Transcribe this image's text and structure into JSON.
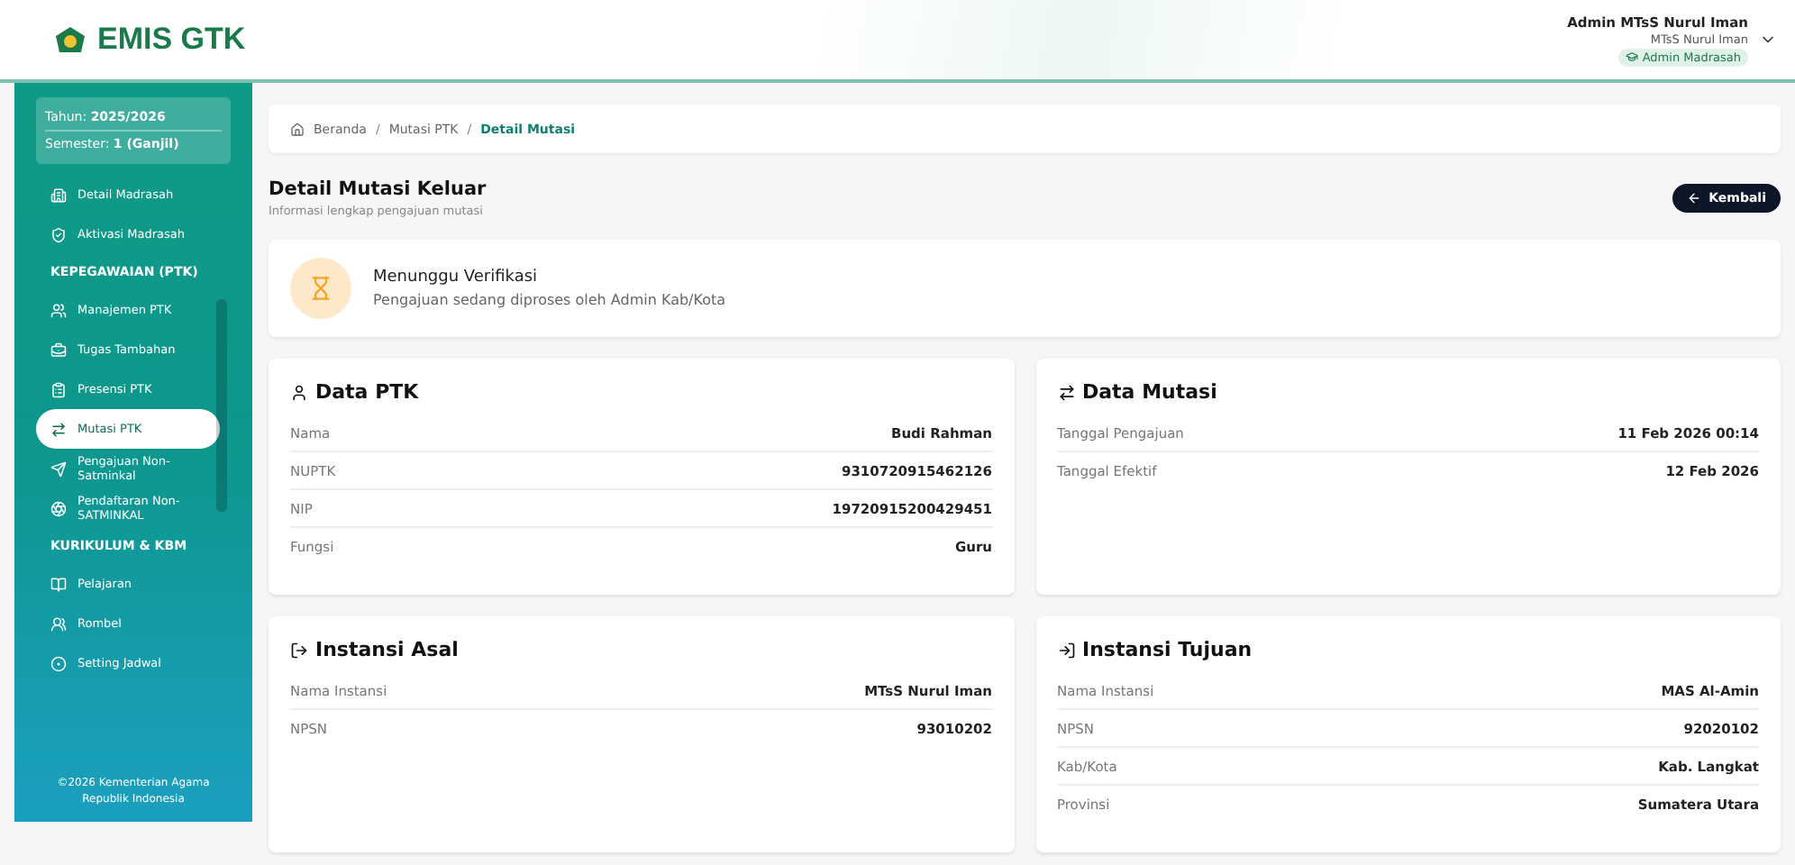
{
  "header": {
    "logo_text": "EMIS GTK",
    "user_name": "Admin MTsS Nurul Iman",
    "user_org": "MTsS Nurul Iman",
    "role_badge": "Admin Madrasah"
  },
  "sidebar": {
    "year_label": "Tahun:",
    "year": "2025/2026",
    "semester_label": "Semester:",
    "semester": "1 (Ganjil)",
    "items": [
      {
        "kind": "item",
        "label": "Detail Madrasah",
        "selected": false
      },
      {
        "kind": "item",
        "label": "Aktivasi Madrasah",
        "selected": false
      },
      {
        "kind": "heading",
        "label": "KEPEGAWAIAN (PTK)"
      },
      {
        "kind": "item",
        "label": "Manajemen PTK",
        "selected": false
      },
      {
        "kind": "item",
        "label": "Tugas Tambahan",
        "selected": false
      },
      {
        "kind": "item",
        "label": "Presensi PTK",
        "selected": false
      },
      {
        "kind": "item",
        "label": "Mutasi PTK",
        "selected": true
      },
      {
        "kind": "item",
        "label": "Pengajuan Non-Satminkal",
        "selected": false
      },
      {
        "kind": "item",
        "label": "Pendaftaran Non-SATMINKAL",
        "selected": false
      },
      {
        "kind": "heading",
        "label": "KURIKULUM & KBM"
      },
      {
        "kind": "item",
        "label": "Pelajaran",
        "selected": false
      },
      {
        "kind": "item",
        "label": "Rombel",
        "selected": false
      },
      {
        "kind": "item",
        "label": "Setting Jadwal",
        "selected": false
      }
    ],
    "footer": "©2026 Kementerian Agama Republik Indonesia"
  },
  "breadcrumb_separator": "/",
  "breadcrumb": [
    {
      "label": "Beranda",
      "selected": false
    },
    {
      "label": "Mutasi PTK",
      "selected": false
    },
    {
      "label": "Detail Mutasi",
      "selected": true
    }
  ],
  "page": {
    "title": "Detail Mutasi Keluar",
    "subtitle": "Informasi lengkap pengajuan mutasi",
    "back_button": "Kembali"
  },
  "status": {
    "title": "Menunggu Verifikasi",
    "message": "Pengajuan sedang diproses oleh Admin Kab/Kota"
  },
  "cards": [
    {
      "title": "Data PTK",
      "rows": [
        {
          "label": "Nama",
          "value": "Budi Rahman"
        },
        {
          "label": "NUPTK",
          "value": "9310720915462126"
        },
        {
          "label": "NIP",
          "value": "19720915200429451"
        },
        {
          "label": "Fungsi",
          "value": "Guru"
        }
      ]
    },
    {
      "title": "Data Mutasi",
      "rows": [
        {
          "label": "Tanggal Pengajuan",
          "value": "11 Feb 2026 00:14"
        },
        {
          "label": "Tanggal Efektif",
          "value": "12 Feb 2026"
        }
      ]
    },
    {
      "title": "Instansi Asal",
      "rows": [
        {
          "label": "Nama Instansi",
          "value": "MTsS Nurul Iman"
        },
        {
          "label": "NPSN",
          "value": "93010202"
        }
      ]
    },
    {
      "title": "Instansi Tujuan",
      "rows": [
        {
          "label": "Nama Instansi",
          "value": "MAS Al-Amin"
        },
        {
          "label": "NPSN",
          "value": "92020102"
        },
        {
          "label": "Kab/Kota",
          "value": "Kab. Langkat"
        },
        {
          "label": "Provinsi",
          "value": "Sumatera Utara"
        }
      ]
    }
  ]
}
